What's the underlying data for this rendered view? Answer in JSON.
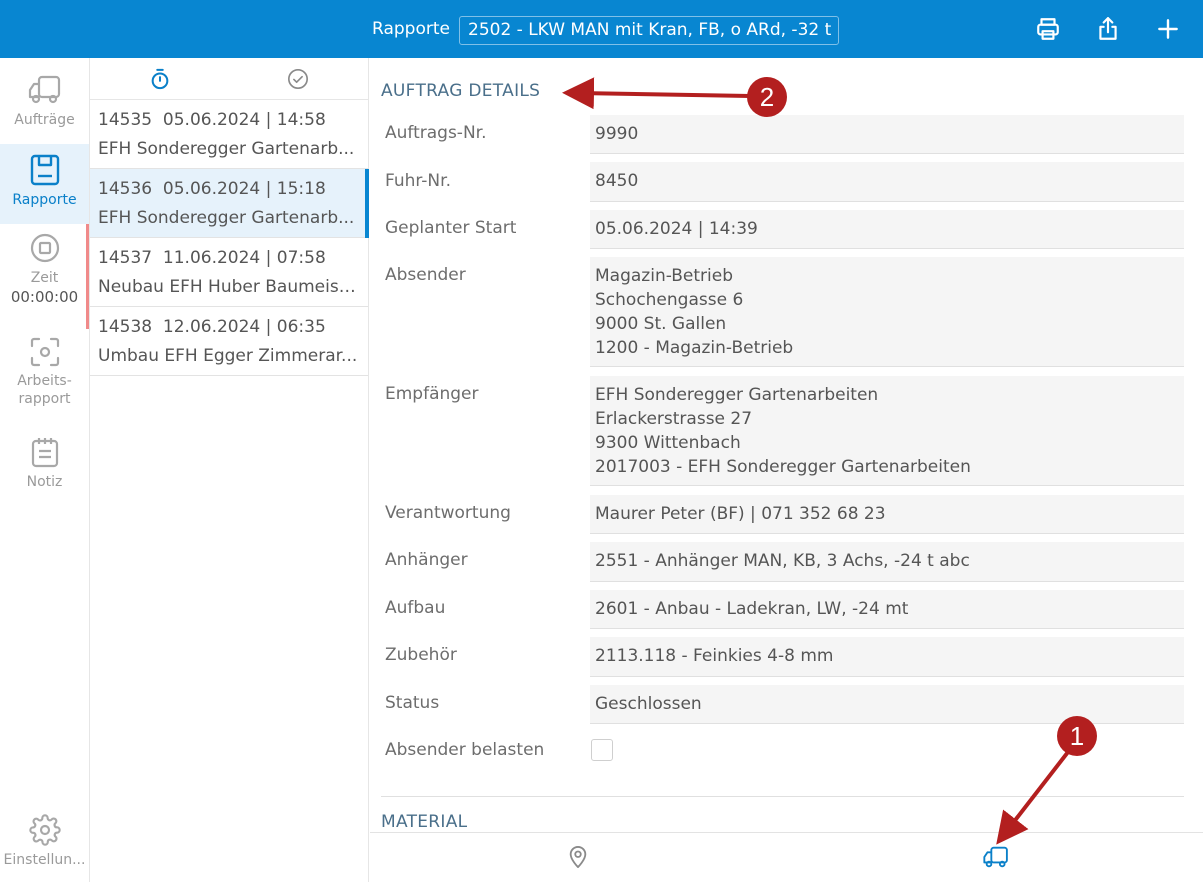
{
  "header": {
    "title": "Rapporte",
    "selected_vehicle": "2502 - LKW MAN mit Kran, FB, o ARd, -32 t",
    "icons": [
      "printer-icon",
      "share-icon",
      "plus-icon"
    ]
  },
  "sidebar": {
    "items": [
      {
        "label": "Aufträge",
        "icon": "truck-icon"
      },
      {
        "label": "Rapporte",
        "icon": "save-icon"
      },
      {
        "label": "Zeit",
        "value": "00:00:00",
        "icon": "stop-icon"
      },
      {
        "label_line1": "Arbeits-",
        "label_line2": "rapport",
        "icon": "scan-icon"
      },
      {
        "label": "Notiz",
        "icon": "notepad-icon"
      }
    ],
    "settings_label": "Einstellun..."
  },
  "list": {
    "header_icons": [
      "stopwatch-icon",
      "check-circle-icon"
    ],
    "items": [
      {
        "id": "14535",
        "datetime": "05.06.2024 | 14:58",
        "title": "EFH Sonderegger Gartenarb..."
      },
      {
        "id": "14536",
        "datetime": "05.06.2024 | 15:18",
        "title": "EFH Sonderegger Gartenarb..."
      },
      {
        "id": "14537",
        "datetime": "11.06.2024 | 07:58",
        "title": "Neubau EFH Huber Baumeist..."
      },
      {
        "id": "14538",
        "datetime": "12.06.2024 | 06:35",
        "title": "Umbau EFH Egger Zimmerar..."
      }
    ]
  },
  "detail": {
    "section_title": "AUFTRAG DETAILS",
    "fields": [
      {
        "label": "Auftrags-Nr.",
        "value": "9990"
      },
      {
        "label": "Fuhr-Nr.",
        "value": "8450"
      },
      {
        "label": "Geplanter Start",
        "value": "05.06.2024 | 14:39"
      },
      {
        "label": "Absender",
        "lines": [
          "Magazin-Betrieb",
          "Schochengasse 6",
          "9000 St. Gallen",
          "1200 - Magazin-Betrieb"
        ]
      },
      {
        "label": "Empfänger",
        "lines": [
          "EFH Sonderegger Gartenarbeiten",
          "Erlackerstrasse 27",
          "9300 Wittenbach",
          "2017003 - EFH Sonderegger Gartenarbeiten"
        ]
      },
      {
        "label": "Verantwortung",
        "value": "Maurer Peter (BF) | 071 352 68 23"
      },
      {
        "label": "Anhänger",
        "value": "2551 - Anhänger MAN, KB, 3 Achs, -24 t abc"
      },
      {
        "label": "Aufbau",
        "value": "2601 - Anbau - Ladekran, LW, -24 mt"
      },
      {
        "label": "Zubehör",
        "value": "2113.118 - Feinkies 4-8 mm"
      },
      {
        "label": "Status",
        "value": "Geschlossen"
      },
      {
        "label": "Absender belasten",
        "checked": false
      }
    ],
    "material_title": "MATERIAL"
  },
  "bottombar": {
    "tabs": [
      "location-pin-icon",
      "truck-icon"
    ],
    "active_tab": "truck-icon"
  },
  "annotations": {
    "badge1": "1",
    "badge2": "2",
    "color": "#b31f1f"
  }
}
